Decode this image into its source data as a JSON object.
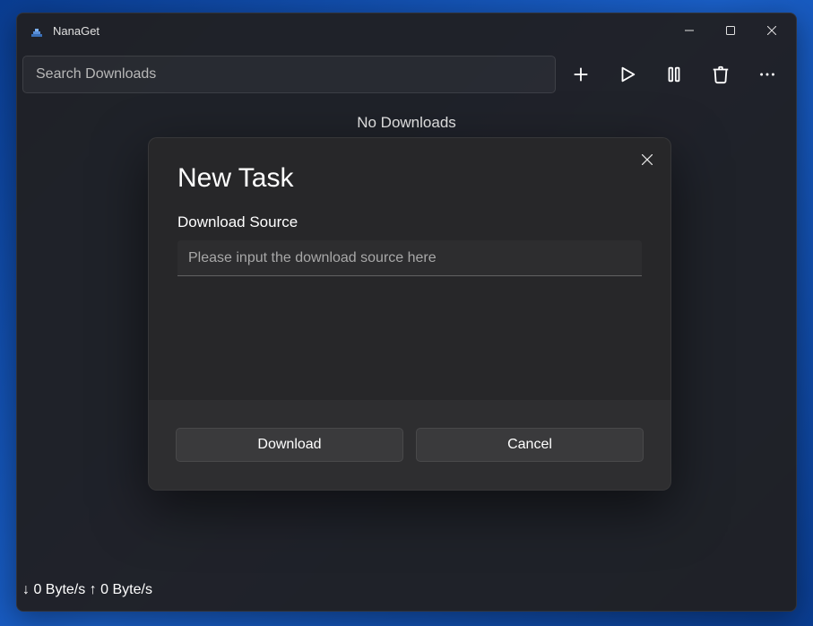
{
  "app": {
    "title": "NanaGet"
  },
  "toolbar": {
    "search_placeholder": "Search Downloads"
  },
  "main": {
    "empty_text": "No Downloads"
  },
  "status": {
    "text": "↓ 0 Byte/s ↑ 0 Byte/s"
  },
  "dialog": {
    "title": "New Task",
    "field_label": "Download Source",
    "source_placeholder": "Please input the download source here",
    "download_label": "Download",
    "cancel_label": "Cancel"
  }
}
